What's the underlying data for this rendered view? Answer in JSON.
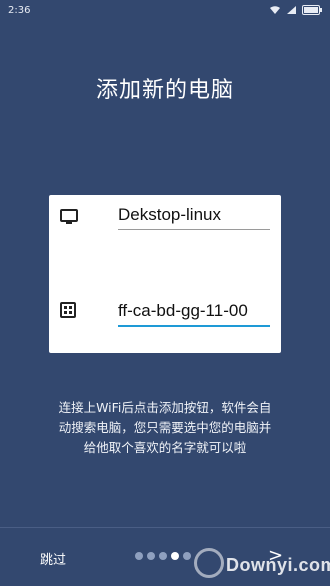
{
  "status_bar": {
    "time": "2:36",
    "icons": [
      "wifi-icon",
      "signal-icon",
      "battery-icon"
    ]
  },
  "page": {
    "title": "添加新的电脑",
    "description": "连接上WiFi后点击添加按钮，软件会自动搜索电脑，您只需要选中您的电脑并给他取个喜欢的名字就可以啦"
  },
  "form": {
    "computer_name": "Dekstop-linux",
    "mac_address": "ff-ca-bd-gg-11-00",
    "icons": [
      "monitor-icon",
      "network-card-icon"
    ]
  },
  "bottom": {
    "skip_label": "跳过",
    "next_label": ">",
    "page_count": 5,
    "current_page": 4
  },
  "watermark": "Downyi.com",
  "colors": {
    "background": "#33486f",
    "accent": "#1e9ad6"
  }
}
